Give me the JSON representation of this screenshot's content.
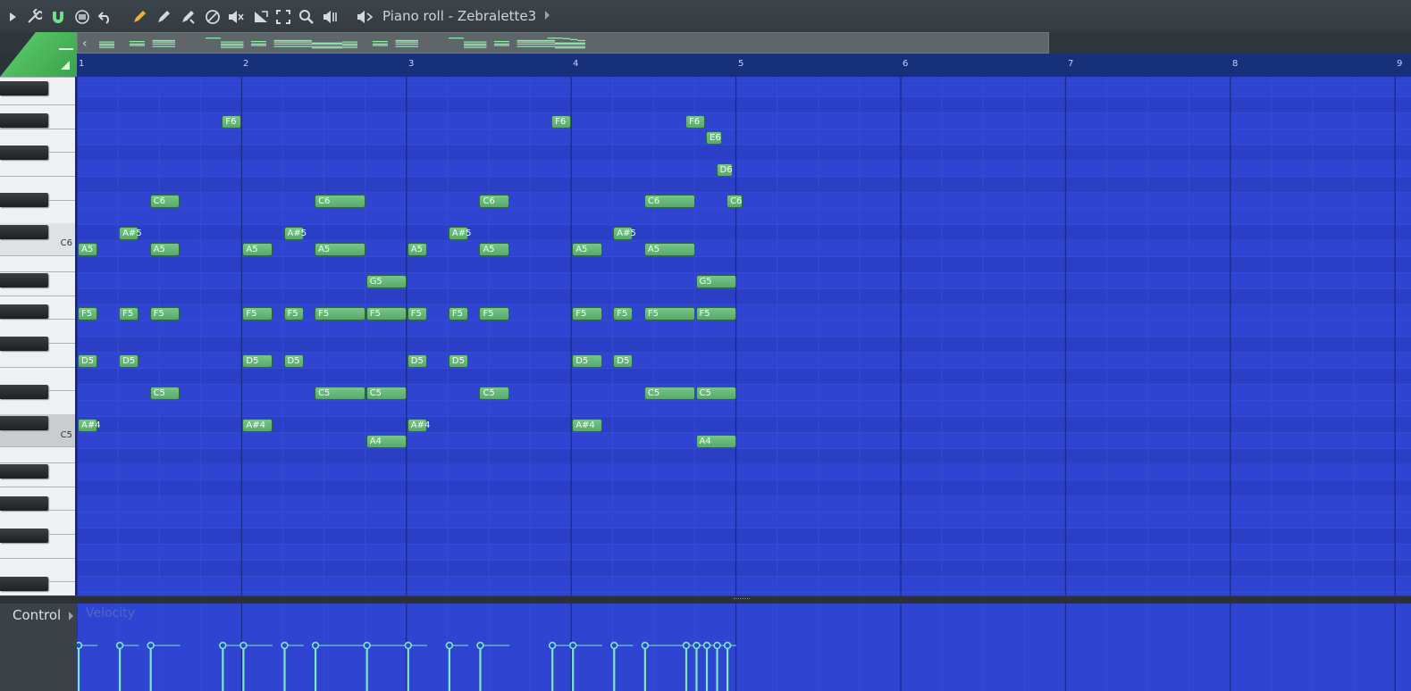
{
  "window": {
    "title": "Piano roll - Zebralette3"
  },
  "toolbar": {
    "icons": [
      "menu-arrow-icon",
      "wrench-icon",
      "magnet-icon",
      "stamp-icon",
      "undo-icon",
      "pencil-icon",
      "paint-icon",
      "slice-icon",
      "delete-icon",
      "mute-icon",
      "slip-icon",
      "select-icon",
      "zoom-icon",
      "playback-icon",
      "speaker-icon"
    ]
  },
  "colors": {
    "grid_bg": "#2f44d0",
    "grid_bg_alt": "#2a3fc6",
    "note_fill": "#6abd7c",
    "accent_green": "#4fbf5f",
    "velocity": "#7ee8c0"
  },
  "ruler": {
    "bars": [
      "1",
      "2",
      "3",
      "4",
      "5",
      "6",
      "7",
      "8",
      "9"
    ]
  },
  "keyboard": {
    "labels": [
      "C6",
      "C5"
    ]
  },
  "notes": [
    {
      "pitch": "A5",
      "start": 0,
      "length": 0.5
    },
    {
      "pitch": "F5",
      "start": 0,
      "length": 0.5
    },
    {
      "pitch": "D5",
      "start": 0,
      "length": 0.5
    },
    {
      "pitch": "A#4",
      "start": 0,
      "length": 0.5
    },
    {
      "pitch": "A#5",
      "start": 1,
      "length": 0.5
    },
    {
      "pitch": "F5",
      "start": 1,
      "length": 0.5
    },
    {
      "pitch": "D5",
      "start": 1,
      "length": 0.5
    },
    {
      "pitch": "C6",
      "start": 1.75,
      "length": 0.75
    },
    {
      "pitch": "A5",
      "start": 1.75,
      "length": 0.75
    },
    {
      "pitch": "F5",
      "start": 1.75,
      "length": 0.75
    },
    {
      "pitch": "C5",
      "start": 1.75,
      "length": 0.75
    },
    {
      "pitch": "F6",
      "start": 3.5,
      "length": 0.5
    },
    {
      "pitch": "A5",
      "start": 4,
      "length": 0.75
    },
    {
      "pitch": "F5",
      "start": 4,
      "length": 0.75
    },
    {
      "pitch": "D5",
      "start": 4,
      "length": 0.75
    },
    {
      "pitch": "A#4",
      "start": 4,
      "length": 0.75
    },
    {
      "pitch": "A#5",
      "start": 5,
      "length": 0.5
    },
    {
      "pitch": "F5",
      "start": 5,
      "length": 0.5
    },
    {
      "pitch": "D5",
      "start": 5,
      "length": 0.5
    },
    {
      "pitch": "C6",
      "start": 5.75,
      "length": 1.25
    },
    {
      "pitch": "A5",
      "start": 5.75,
      "length": 1.25
    },
    {
      "pitch": "F5",
      "start": 5.75,
      "length": 1.25
    },
    {
      "pitch": "C5",
      "start": 5.75,
      "length": 1.25
    },
    {
      "pitch": "G5",
      "start": 7,
      "length": 1
    },
    {
      "pitch": "F5",
      "start": 7,
      "length": 1
    },
    {
      "pitch": "C5",
      "start": 7,
      "length": 1
    },
    {
      "pitch": "A4",
      "start": 7,
      "length": 1
    },
    {
      "pitch": "A5",
      "start": 8,
      "length": 0.5
    },
    {
      "pitch": "F5",
      "start": 8,
      "length": 0.5
    },
    {
      "pitch": "D5",
      "start": 8,
      "length": 0.5
    },
    {
      "pitch": "A#4",
      "start": 8,
      "length": 0.5
    },
    {
      "pitch": "A#5",
      "start": 9,
      "length": 0.5
    },
    {
      "pitch": "F5",
      "start": 9,
      "length": 0.5
    },
    {
      "pitch": "D5",
      "start": 9,
      "length": 0.5
    },
    {
      "pitch": "C6",
      "start": 9.75,
      "length": 0.75
    },
    {
      "pitch": "A5",
      "start": 9.75,
      "length": 0.75
    },
    {
      "pitch": "F5",
      "start": 9.75,
      "length": 0.75
    },
    {
      "pitch": "C5",
      "start": 9.75,
      "length": 0.75
    },
    {
      "pitch": "F6",
      "start": 11.5,
      "length": 0.5
    },
    {
      "pitch": "A5",
      "start": 12,
      "length": 0.75
    },
    {
      "pitch": "F5",
      "start": 12,
      "length": 0.75
    },
    {
      "pitch": "D5",
      "start": 12,
      "length": 0.75
    },
    {
      "pitch": "A#4",
      "start": 12,
      "length": 0.75
    },
    {
      "pitch": "A#5",
      "start": 13,
      "length": 0.5
    },
    {
      "pitch": "F5",
      "start": 13,
      "length": 0.5
    },
    {
      "pitch": "D5",
      "start": 13,
      "length": 0.5
    },
    {
      "pitch": "C6",
      "start": 13.75,
      "length": 1.25
    },
    {
      "pitch": "A5",
      "start": 13.75,
      "length": 1.25
    },
    {
      "pitch": "F5",
      "start": 13.75,
      "length": 1.25
    },
    {
      "pitch": "C5",
      "start": 13.75,
      "length": 1.25
    },
    {
      "pitch": "F6",
      "start": 14.75,
      "length": 0.5
    },
    {
      "pitch": "E6",
      "start": 15.25,
      "length": 0.25
    },
    {
      "pitch": "D6",
      "start": 15.5,
      "length": 0.25
    },
    {
      "pitch": "G5",
      "start": 15,
      "length": 1
    },
    {
      "pitch": "F5",
      "start": 15,
      "length": 1
    },
    {
      "pitch": "C5",
      "start": 15,
      "length": 1
    },
    {
      "pitch": "A4",
      "start": 15,
      "length": 1
    },
    {
      "pitch": "C6",
      "start": 15.75,
      "length": 0.25
    }
  ],
  "velocity_events": [
    0,
    1,
    1.75,
    3.5,
    4,
    5,
    5.75,
    7,
    8,
    9,
    9.75,
    11.5,
    12,
    13,
    13.75,
    14.75,
    15,
    15.25,
    15.5,
    15.75
  ],
  "control": {
    "label": "Control",
    "parameter": "Velocity"
  }
}
